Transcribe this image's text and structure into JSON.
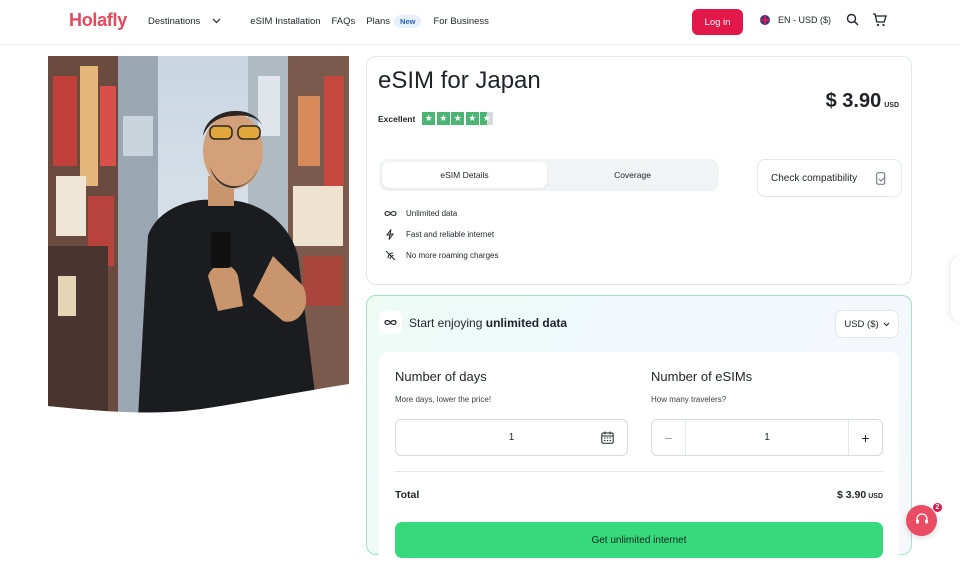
{
  "header": {
    "logo": "Holafly",
    "nav": {
      "destinations": "Destinations",
      "installation": "eSIM Installation",
      "faqs": "FAQs",
      "plans": "Plans",
      "plans_badge": "New",
      "business": "For Business"
    },
    "login": "Log in",
    "language": "EN - USD ($)"
  },
  "product": {
    "title": "eSIM for Japan",
    "rating_label": "Excellent",
    "rating_stars": 4.5,
    "price": "$ 3.90",
    "price_currency": "USD",
    "tabs": [
      "eSIM Details",
      "Coverage"
    ],
    "active_tab": "eSIM Details",
    "check_compat": "Check compatibility",
    "features": [
      "Unlimited data",
      "Fast and reliable internet",
      "No more roaming charges"
    ]
  },
  "purchase": {
    "title_prefix": "Start enjoying",
    "title_bold": "unlimited data",
    "currency": "USD ($)",
    "days_title": "Number of days",
    "days_sub": "More days, lower the price!",
    "days_value": "1",
    "esims_title": "Number of eSIMs",
    "esims_sub": "How many travelers?",
    "esims_value": "1",
    "total_label": "Total",
    "total_price": "$ 3.90",
    "total_currency": "USD",
    "cta": "Get unlimited internet"
  },
  "chat": {
    "badge": "2"
  },
  "colors": {
    "brand": "#e2184a",
    "cta": "#36d97c",
    "star": "#4bb673"
  }
}
